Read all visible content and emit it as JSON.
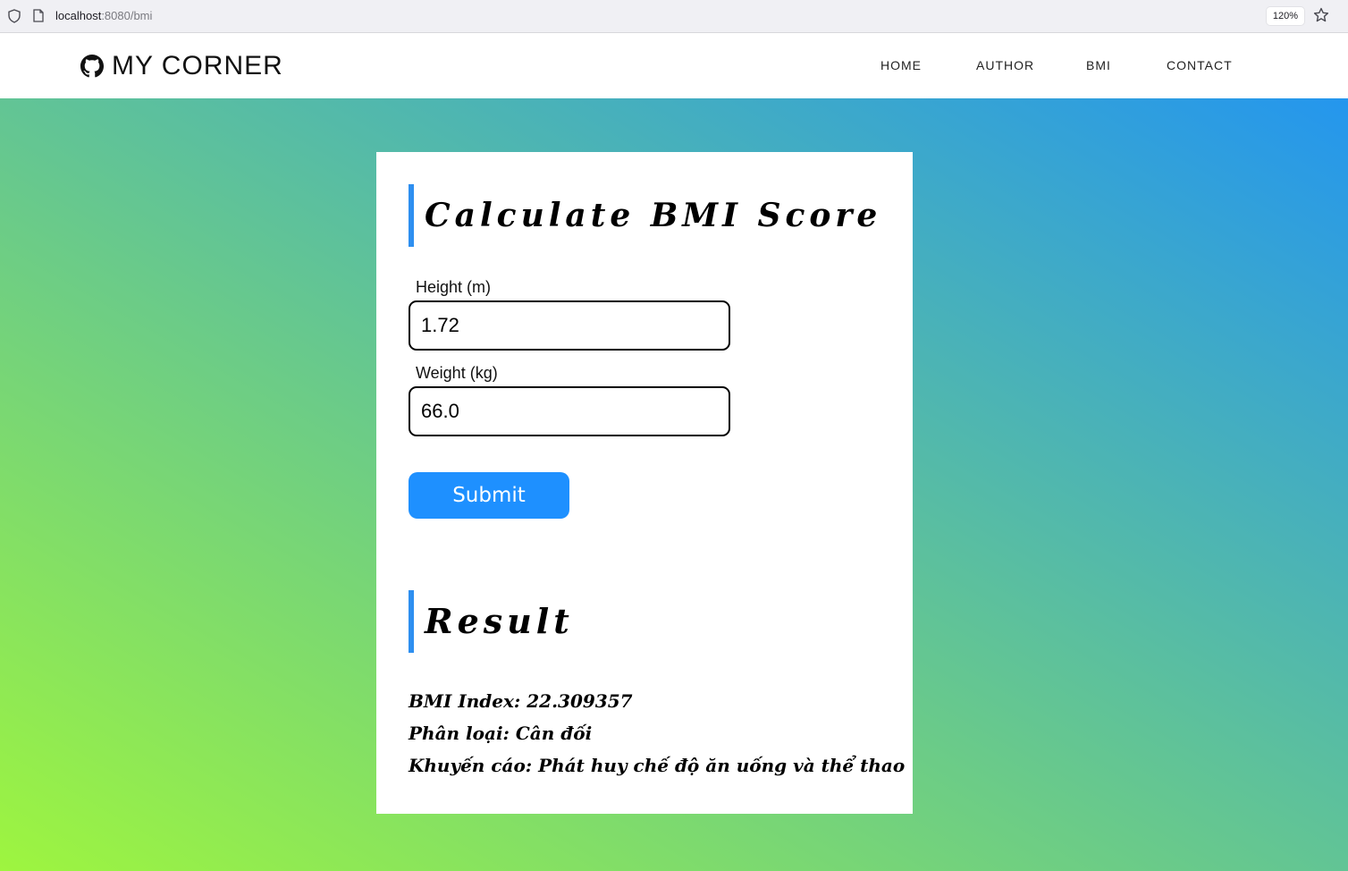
{
  "browser": {
    "url_host": "localhost",
    "url_rest": ":8080/bmi",
    "zoom": "120%"
  },
  "nav": {
    "brand": "MY CORNER",
    "links": [
      "HOME",
      "AUTHOR",
      "BMI",
      "CONTACT"
    ]
  },
  "form": {
    "title": "Calculate BMI Score",
    "height_label": "Height (m)",
    "height_value": "1.72",
    "weight_label": "Weight (kg)",
    "weight_value": "66.0",
    "submit_label": "Submit"
  },
  "result": {
    "title": "Result",
    "bmi_line": "BMI Index: 22.309357",
    "classification_line": "Phân loại: Cân đối",
    "advice_line": "Khuyến cáo: Phát huy chế độ ăn uống và thể thao"
  },
  "colors": {
    "accent": "#1e90ff",
    "gradient_start": "#9ef53f",
    "gradient_end": "#2496ee"
  },
  "icons": {
    "brand": "github-icon",
    "browser_left": [
      "shield-icon",
      "page-icon"
    ],
    "browser_right": "star-icon"
  }
}
